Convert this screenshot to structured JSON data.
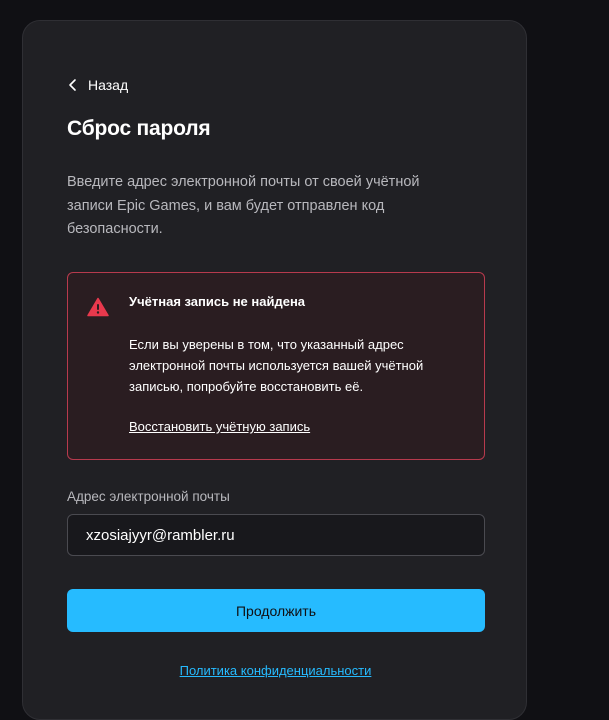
{
  "nav": {
    "back_label": "Назад",
    "back_icon": "chevron-left-icon"
  },
  "page": {
    "title": "Сброс пароля",
    "description": "Введите адрес электронной почты от своей учётной записи Epic Games, и вам будет отправлен код безопасности."
  },
  "alert": {
    "icon": "warning-triangle-icon",
    "title": "Учётная запись не найдена",
    "message": "Если вы уверены в том, что указанный адрес электронной почты используется вашей учётной записью, попробуйте восстановить её.",
    "link_label": "Восстановить учётную запись",
    "color": "#e8394d"
  },
  "form": {
    "email_label": "Адрес электронной почты",
    "email_value": "xzosiajyyr@rambler.ru",
    "submit_label": "Продолжить"
  },
  "footer": {
    "privacy_label": "Политика конфиденциальности"
  },
  "colors": {
    "background": "#101014",
    "card": "#202024",
    "accent": "#26bbff",
    "error_border": "#b73a4d"
  }
}
